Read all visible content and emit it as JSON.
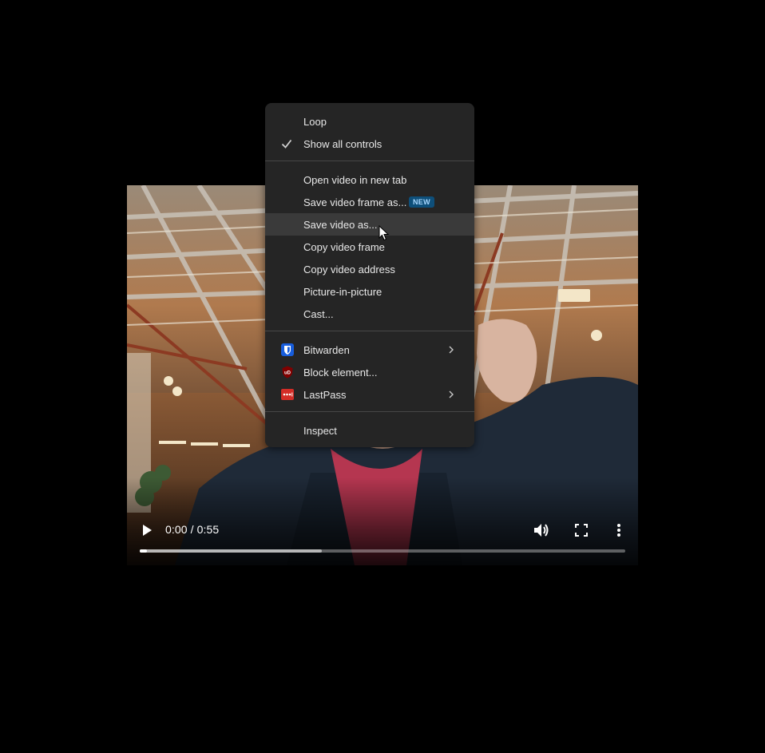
{
  "video": {
    "time_display": "0:00 / 0:55",
    "progress": {
      "played_fraction": 0.015,
      "buffered_fraction": 0.375
    },
    "controls": {
      "play_icon": "play-icon",
      "volume_icon": "volume-icon",
      "fullscreen_icon": "fullscreen-icon",
      "more_icon": "more-vert-icon"
    }
  },
  "context_menu": {
    "section_playback": [
      {
        "label": "Loop",
        "checked": false
      },
      {
        "label": "Show all controls",
        "checked": true,
        "icon": "checkmark-icon"
      }
    ],
    "section_video": [
      {
        "label": "Open video in new tab"
      },
      {
        "label": "Save video frame as...",
        "badge": "NEW"
      },
      {
        "label": "Save video as...",
        "hovered": true
      },
      {
        "label": "Copy video frame"
      },
      {
        "label": "Copy video address"
      },
      {
        "label": "Picture-in-picture"
      },
      {
        "label": "Cast..."
      }
    ],
    "section_extensions": [
      {
        "label": "Bitwarden",
        "icon": "bitwarden-icon",
        "submenu": true
      },
      {
        "label": "Block element...",
        "icon": "ublock-origin-icon",
        "submenu": false
      },
      {
        "label": "LastPass",
        "icon": "lastpass-icon",
        "submenu": true
      }
    ],
    "section_dev": [
      {
        "label": "Inspect"
      }
    ]
  },
  "colors": {
    "menu_background": "#252525",
    "menu_hover": "#3a3a3a",
    "badge_background": "#0e4f7a",
    "bitwarden_blue": "#175ddc",
    "ublock_red": "#800000",
    "lastpass_red": "#d32d27"
  }
}
